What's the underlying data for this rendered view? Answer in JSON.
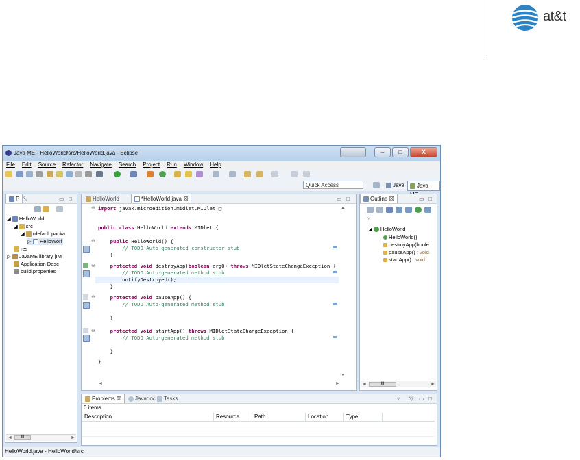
{
  "brand": {
    "name": "at&t"
  },
  "window": {
    "title": "Java ME - HelloWorld/src/HelloWorld.java - Eclipse",
    "controls": [
      "–",
      "□",
      "X"
    ]
  },
  "menu": [
    "File",
    "Edit",
    "Source",
    "Refactor",
    "Navigate",
    "Search",
    "Project",
    "Run",
    "Window",
    "Help"
  ],
  "toolbar2": {
    "quick_access": "Quick Access",
    "perspectives": [
      "Java",
      "Java ME"
    ]
  },
  "explorer": {
    "tab": "P",
    "tab2": "²₁",
    "items": [
      {
        "label": "HelloWorld"
      },
      {
        "label": "src"
      },
      {
        "label": "(default packa"
      },
      {
        "label": "HelloWorl"
      },
      {
        "label": "res"
      },
      {
        "label": "JavaME library [IM"
      },
      {
        "label": "Application Desc"
      },
      {
        "label": "build.properties"
      }
    ],
    "scroll": {
      "left": "◄",
      "thumb": "III",
      "right": "►"
    }
  },
  "editor": {
    "tabs": [
      "HelloWorld",
      "*HelloWorld.java"
    ],
    "lines": [
      {
        "segs": [
          [
            "import",
            "kw"
          ],
          [
            " javax.microedition.midlet.MIDlet;□",
            ""
          ]
        ]
      },
      {
        "segs": [
          [
            "public class",
            "kw"
          ],
          [
            " HelloWorld ",
            ""
          ],
          [
            "extends",
            "kw"
          ],
          [
            " MIDlet {",
            ""
          ]
        ]
      },
      {
        "segs": [
          [
            "    public",
            "kw"
          ],
          [
            " HelloWorld() {",
            ""
          ]
        ]
      },
      {
        "segs": [
          [
            "        // TODO Auto-generated constructor stub",
            "cm"
          ]
        ]
      },
      {
        "segs": [
          [
            "    }",
            ""
          ]
        ]
      },
      {
        "segs": [
          [
            "    protected void",
            "kw"
          ],
          [
            " destroyApp(",
            ""
          ],
          [
            "boolean",
            "kw"
          ],
          [
            " arg0) ",
            ""
          ],
          [
            "throws",
            "kw"
          ],
          [
            " MIDletStateChangeException {",
            ""
          ]
        ]
      },
      {
        "segs": [
          [
            "        // TODO Auto-generated method stub",
            "cm"
          ]
        ]
      },
      {
        "segs": [
          [
            "        notifyDestroyed();",
            ""
          ]
        ]
      },
      {
        "segs": [
          [
            "    }",
            ""
          ]
        ]
      },
      {
        "segs": [
          [
            "    protected void",
            "kw"
          ],
          [
            " pauseApp() {",
            ""
          ]
        ]
      },
      {
        "segs": [
          [
            "        // TODO Auto-generated method stub",
            "cm"
          ]
        ]
      },
      {
        "segs": [
          [
            "    }",
            ""
          ]
        ]
      },
      {
        "segs": [
          [
            "    protected void",
            "kw"
          ],
          [
            " startApp() ",
            ""
          ],
          [
            "throws",
            "kw"
          ],
          [
            " MIDletStateChangeException {",
            ""
          ]
        ]
      },
      {
        "segs": [
          [
            "        // TODO Auto-generated method stub",
            "cm"
          ]
        ]
      },
      {
        "segs": [
          [
            "    }",
            ""
          ]
        ]
      },
      {
        "segs": [
          [
            "}",
            ""
          ]
        ]
      }
    ]
  },
  "outline": {
    "tab": "Outline",
    "items": [
      {
        "label": "HelloWorld",
        "suffix": ""
      },
      {
        "label": "HelloWorld()",
        "suffix": ""
      },
      {
        "label": "destroyApp(boole",
        "suffix": ""
      },
      {
        "label": "pauseApp()",
        "suffix": " : void"
      },
      {
        "label": "startApp()",
        "suffix": " : void"
      }
    ],
    "scroll": {
      "left": "◄",
      "thumb": "III",
      "right": "►"
    }
  },
  "problems": {
    "tabs": [
      "Problems",
      "Javadoc",
      "Tasks"
    ],
    "count": "0 items",
    "columns": [
      "Description",
      "Resource",
      "Path",
      "Location",
      "Type"
    ]
  },
  "status": {
    "text": "HelloWorld.java - HelloWorld/src"
  },
  "colors": {
    "keyword": "#7f0055",
    "comment": "#3f7f5f",
    "frame": "#d8e4f1"
  }
}
